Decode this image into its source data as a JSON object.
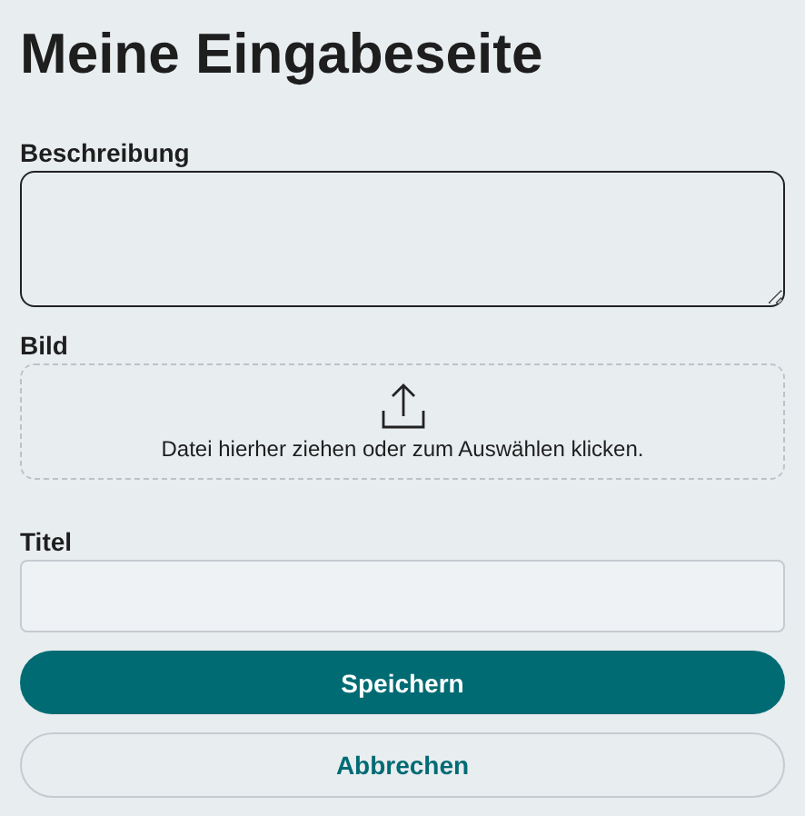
{
  "title": "Meine Eingabeseite",
  "fields": [
    {
      "kind": "textarea",
      "label": "Beschreibung"
    },
    {
      "kind": "upload",
      "label": "Bild",
      "hint": "Datei hierher ziehen oder zum Auswählen klicken."
    },
    {
      "kind": "input",
      "label": "Titel"
    }
  ],
  "buttons": [
    {
      "kind": "primary",
      "label": "Speichern"
    },
    {
      "kind": "secondary",
      "label": "Abbrechen"
    }
  ]
}
